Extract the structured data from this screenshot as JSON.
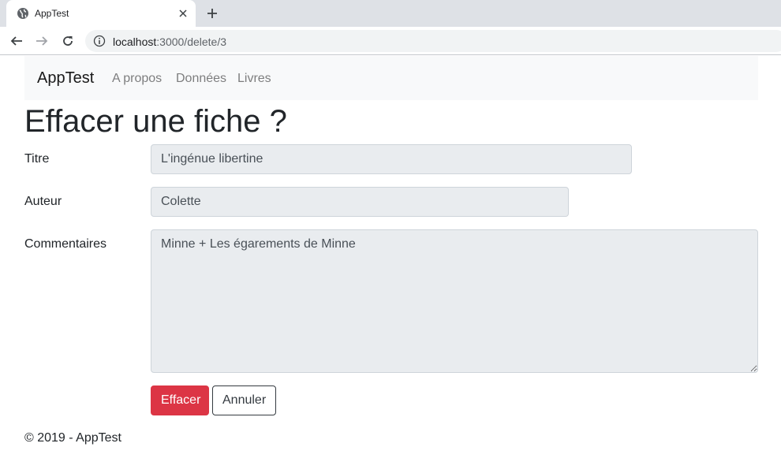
{
  "browser": {
    "tab_title": "AppTest",
    "url_host": "localhost",
    "url_path": ":3000/delete/3"
  },
  "navbar": {
    "brand": "AppTest",
    "links": [
      "A propos",
      "Données",
      "Livres"
    ]
  },
  "page": {
    "title": "Effacer une fiche ?"
  },
  "form": {
    "titre_label": "Titre",
    "titre_value": "L'ingénue libertine",
    "auteur_label": "Auteur",
    "auteur_value": "Colette",
    "commentaires_label": "Commentaires",
    "commentaires_value": "Minne + Les égarements de Minne",
    "delete_label": "Effacer",
    "cancel_label": "Annuler"
  },
  "footer": {
    "text": "© 2019 - AppTest"
  },
  "colors": {
    "danger": "#dc3545",
    "navbar_bg": "#f8f9fa",
    "readonly_bg": "#e9ecef"
  },
  "icons": {
    "favicon": "globe-icon",
    "tab_close": "close-icon",
    "new_tab": "plus-icon",
    "back": "arrow-left-icon",
    "forward": "arrow-right-icon",
    "reload": "reload-icon",
    "site_info": "info-icon"
  }
}
